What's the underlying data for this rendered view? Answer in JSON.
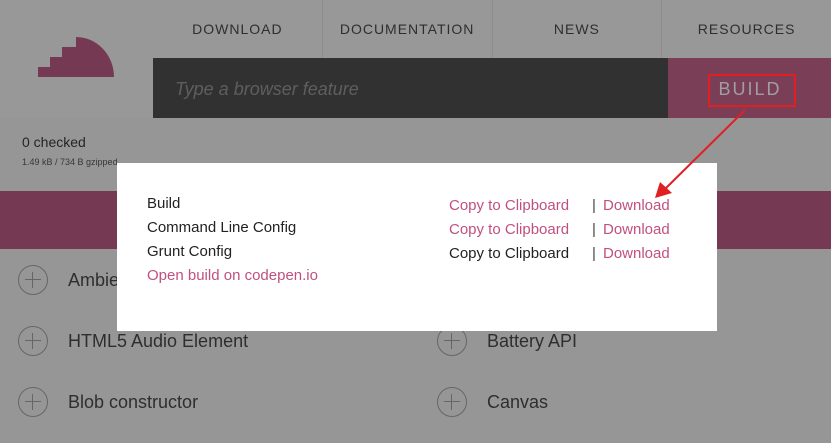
{
  "nav": {
    "items": [
      "DOWNLOAD",
      "DOCUMENTATION",
      "NEWS",
      "RESOURCES"
    ]
  },
  "search": {
    "placeholder": "Type a browser feature"
  },
  "build": {
    "label": "BUILD"
  },
  "status": {
    "checked": "0 checked",
    "size": "1.49 kB / 734 B gzipped"
  },
  "features": [
    "Ambient Light Events",
    "HTML5 Audio Element",
    "Battery API",
    "Blob constructor",
    "Canvas"
  ],
  "modal": {
    "rows": [
      {
        "label": "Build",
        "copy": "Copy to Clipboard",
        "download": "Download"
      },
      {
        "label": "Command Line Config",
        "copy": "Copy to Clipboard",
        "download": "Download"
      },
      {
        "label": "Grunt Config",
        "copy": "Copy to Clipboard",
        "download": "Download"
      }
    ],
    "separator": "|",
    "codepen": "Open build on codepen.io"
  },
  "colors": {
    "accent": "#c0507f",
    "search_bg": "#3a3a3a",
    "annotation": "#e02020"
  }
}
